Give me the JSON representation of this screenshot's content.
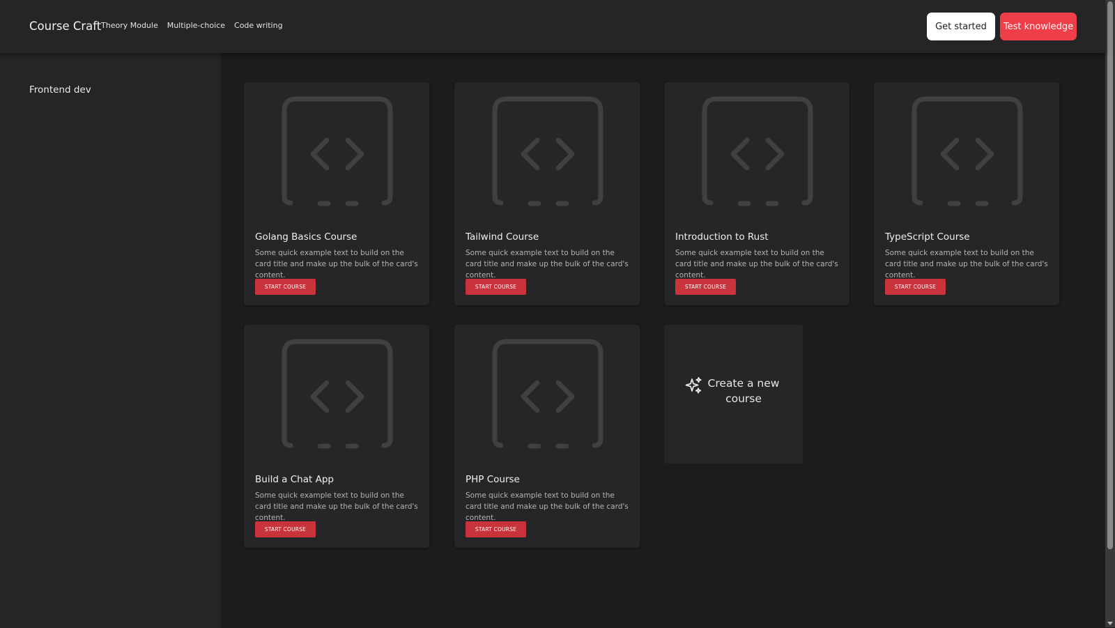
{
  "nav": {
    "brand": "Course Craft",
    "links": [
      "Theory Module",
      "Multiple-choice",
      "Code writing"
    ],
    "get_started_label": "Get started",
    "test_label": "Test knowledge"
  },
  "sidebar": {
    "items": [
      {
        "label": "Frontend dev"
      }
    ]
  },
  "courses": [
    {
      "title": "Golang Basics Course",
      "text": "Some quick example text to build on the card title and make up the bulk of the card's content.",
      "button": "START COURSE",
      "icon": "code-icon"
    },
    {
      "title": "Tailwind Course",
      "text": "Some quick example text to build on the card title and make up the bulk of the card's content.",
      "button": "START COURSE",
      "icon": "code-icon"
    },
    {
      "title": "Introduction to Rust",
      "text": "Some quick example text to build on the card title and make up the bulk of the card's content.",
      "button": "START COURSE",
      "icon": "code-icon"
    },
    {
      "title": "TypeScript Course",
      "text": "Some quick example text to build on the card title and make up the bulk of the card's content.",
      "button": "START COURSE",
      "icon": "code-icon"
    },
    {
      "title": "Build a Chat App",
      "text": "Some quick example text to build on the card title and make up the bulk of the card's content.",
      "button": "START COURSE",
      "icon": "code-icon"
    },
    {
      "title": "PHP Course",
      "text": "Some quick example text to build on the card title and make up the bulk of the card's content.",
      "button": "START COURSE",
      "icon": "code-icon"
    }
  ],
  "new_course": {
    "label": "Create a new course",
    "icon": "sparkles-icon"
  },
  "colors": {
    "accent": "#ee3e47",
    "button": "#c9343c",
    "background": "#1c1c1e",
    "panel": "#252527",
    "card": "#262628"
  }
}
